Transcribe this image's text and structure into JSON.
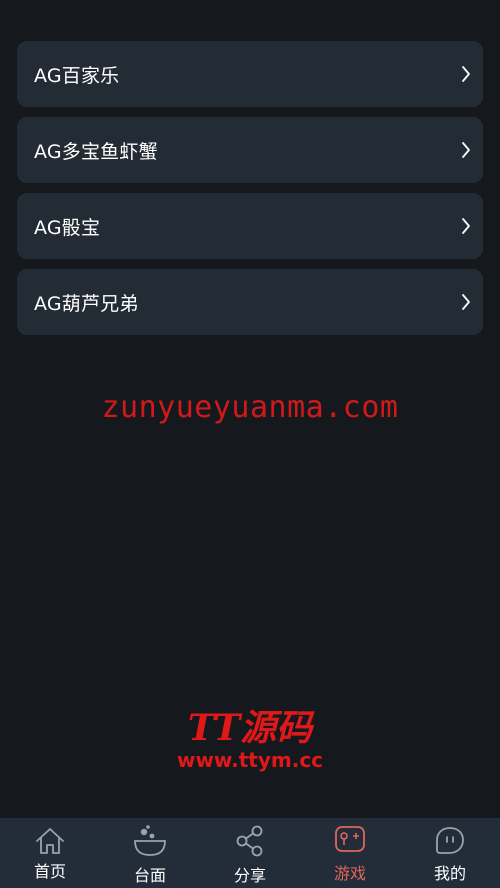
{
  "game_list": [
    {
      "label": "AG百家乐"
    },
    {
      "label": "AG多宝鱼虾蟹"
    },
    {
      "label": "AG骰宝"
    },
    {
      "label": "AG葫芦兄弟"
    }
  ],
  "watermarks": {
    "site": "zunyueyuanma.com",
    "brand": "TT源码",
    "brand_url": "www.ttym.cc"
  },
  "tabbar": {
    "home": "首页",
    "table": "台面",
    "share": "分享",
    "games": "游戏",
    "mine": "我的"
  },
  "colors": {
    "background": "#15191e",
    "card": "#232b35",
    "tabbar": "#232d3a",
    "active": "#e0655a",
    "watermark": "#d01a1a"
  },
  "icons": {
    "chevron": "chevron-right-icon",
    "home": "home-icon",
    "table": "bowl-icon",
    "share": "share-icon",
    "games": "gamepad-icon",
    "mine": "chat-face-icon"
  }
}
